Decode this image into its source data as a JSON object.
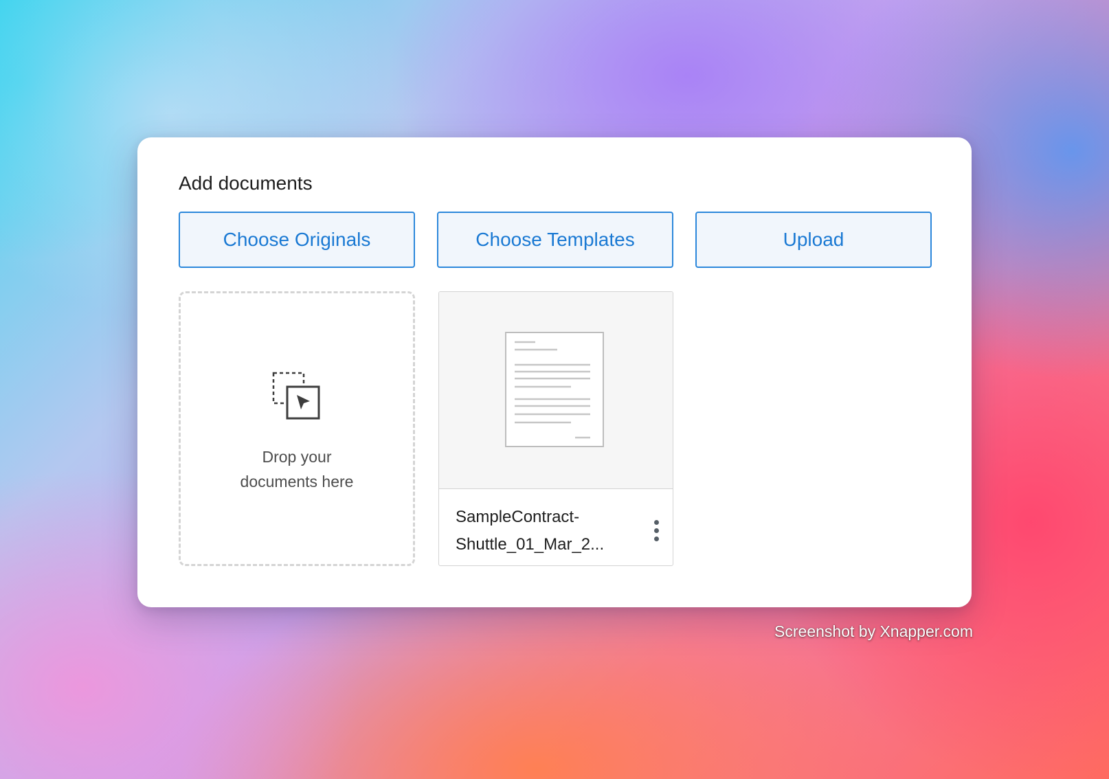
{
  "panel": {
    "heading": "Add documents"
  },
  "buttons": {
    "choose_originals": "Choose Originals",
    "choose_templates": "Choose Templates",
    "upload": "Upload"
  },
  "dropzone": {
    "line1": "Drop your",
    "line2": "documents here",
    "icon": "drag-drop-icon"
  },
  "document": {
    "name_line1": "SampleContract-",
    "name_line2": "Shuttle_01_Mar_2...",
    "thumbnail_icon": "document-thumbnail-icon",
    "menu_icon": "more-vertical-icon"
  },
  "watermark": "Screenshot by Xnapper.com",
  "colors": {
    "accent": "#1a79d3",
    "button_border": "#2b87db",
    "button_background": "#f1f6fc",
    "card_background": "#ffffff"
  }
}
